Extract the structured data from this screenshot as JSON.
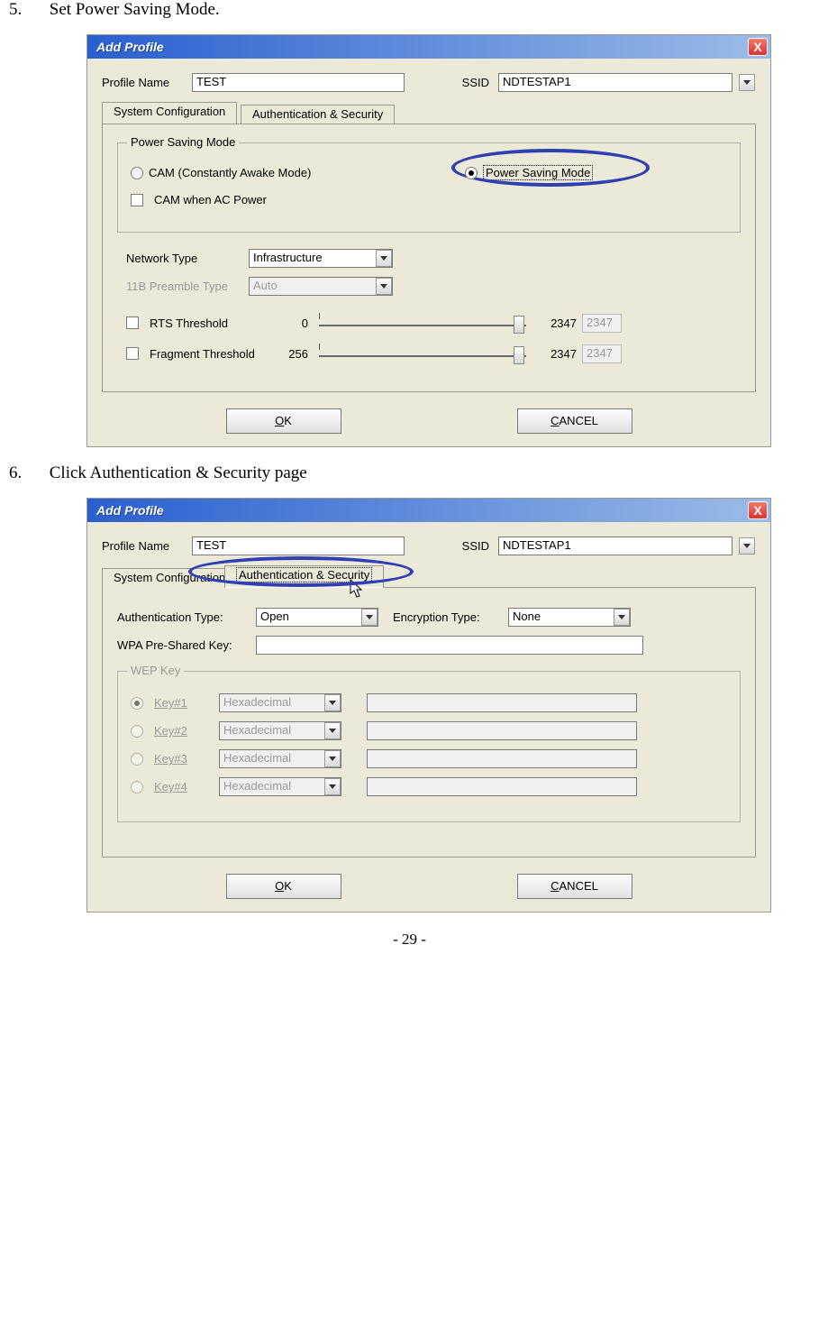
{
  "page": {
    "footer": "- 29 -"
  },
  "steps": {
    "s5": {
      "num": "5.",
      "text": "Set Power Saving Mode."
    },
    "s6": {
      "num": "6.",
      "text": "Click Authentication & Security page"
    }
  },
  "dialog1": {
    "title": "Add Profile",
    "profile_name_label": "Profile Name",
    "profile_name_value": "TEST",
    "ssid_label": "SSID",
    "ssid_value": "NDTESTAP1",
    "tab_sysconfig": "System Configuration",
    "tab_authsec": "Authentication & Security",
    "psm_group": "Power Saving Mode",
    "radio_cam": "CAM (Constantly Awake Mode)",
    "radio_psm": "Power Saving Mode",
    "chk_camac": "CAM when AC Power",
    "network_type_label": "Network Type",
    "network_type_value": "Infrastructure",
    "preamble_label": "11B Preamble Type",
    "preamble_value": "Auto",
    "rts_label": "RTS Threshold",
    "rts_min": "0",
    "rts_val": "2347",
    "rts_box": "2347",
    "frag_label": "Fragment Threshold",
    "frag_min": "256",
    "frag_val": "2347",
    "frag_box": "2347",
    "ok": "OK",
    "ok_u": "O",
    "cancel": "CANCEL",
    "cancel_u": "C"
  },
  "dialog2": {
    "title": "Add Profile",
    "profile_name_label": "Profile Name",
    "profile_name_value": "TEST",
    "ssid_label": "SSID",
    "ssid_value": "NDTESTAP1",
    "tab_sysconfig": "System Configuration",
    "tab_authsec": "Authentication & Security",
    "auth_type_label": "Authentication Type:",
    "auth_type_value": "Open",
    "enc_type_label": "Encryption Type:",
    "enc_type_value": "None",
    "wpa_psk_label": "WPA Pre-Shared Key:",
    "wep_group": "WEP Key",
    "key1": "Key#1",
    "key2": "Key#2",
    "key3": "Key#3",
    "key4": "Key#4",
    "key_format": "Hexadecimal",
    "ok": "OK",
    "cancel": "CANCEL"
  }
}
